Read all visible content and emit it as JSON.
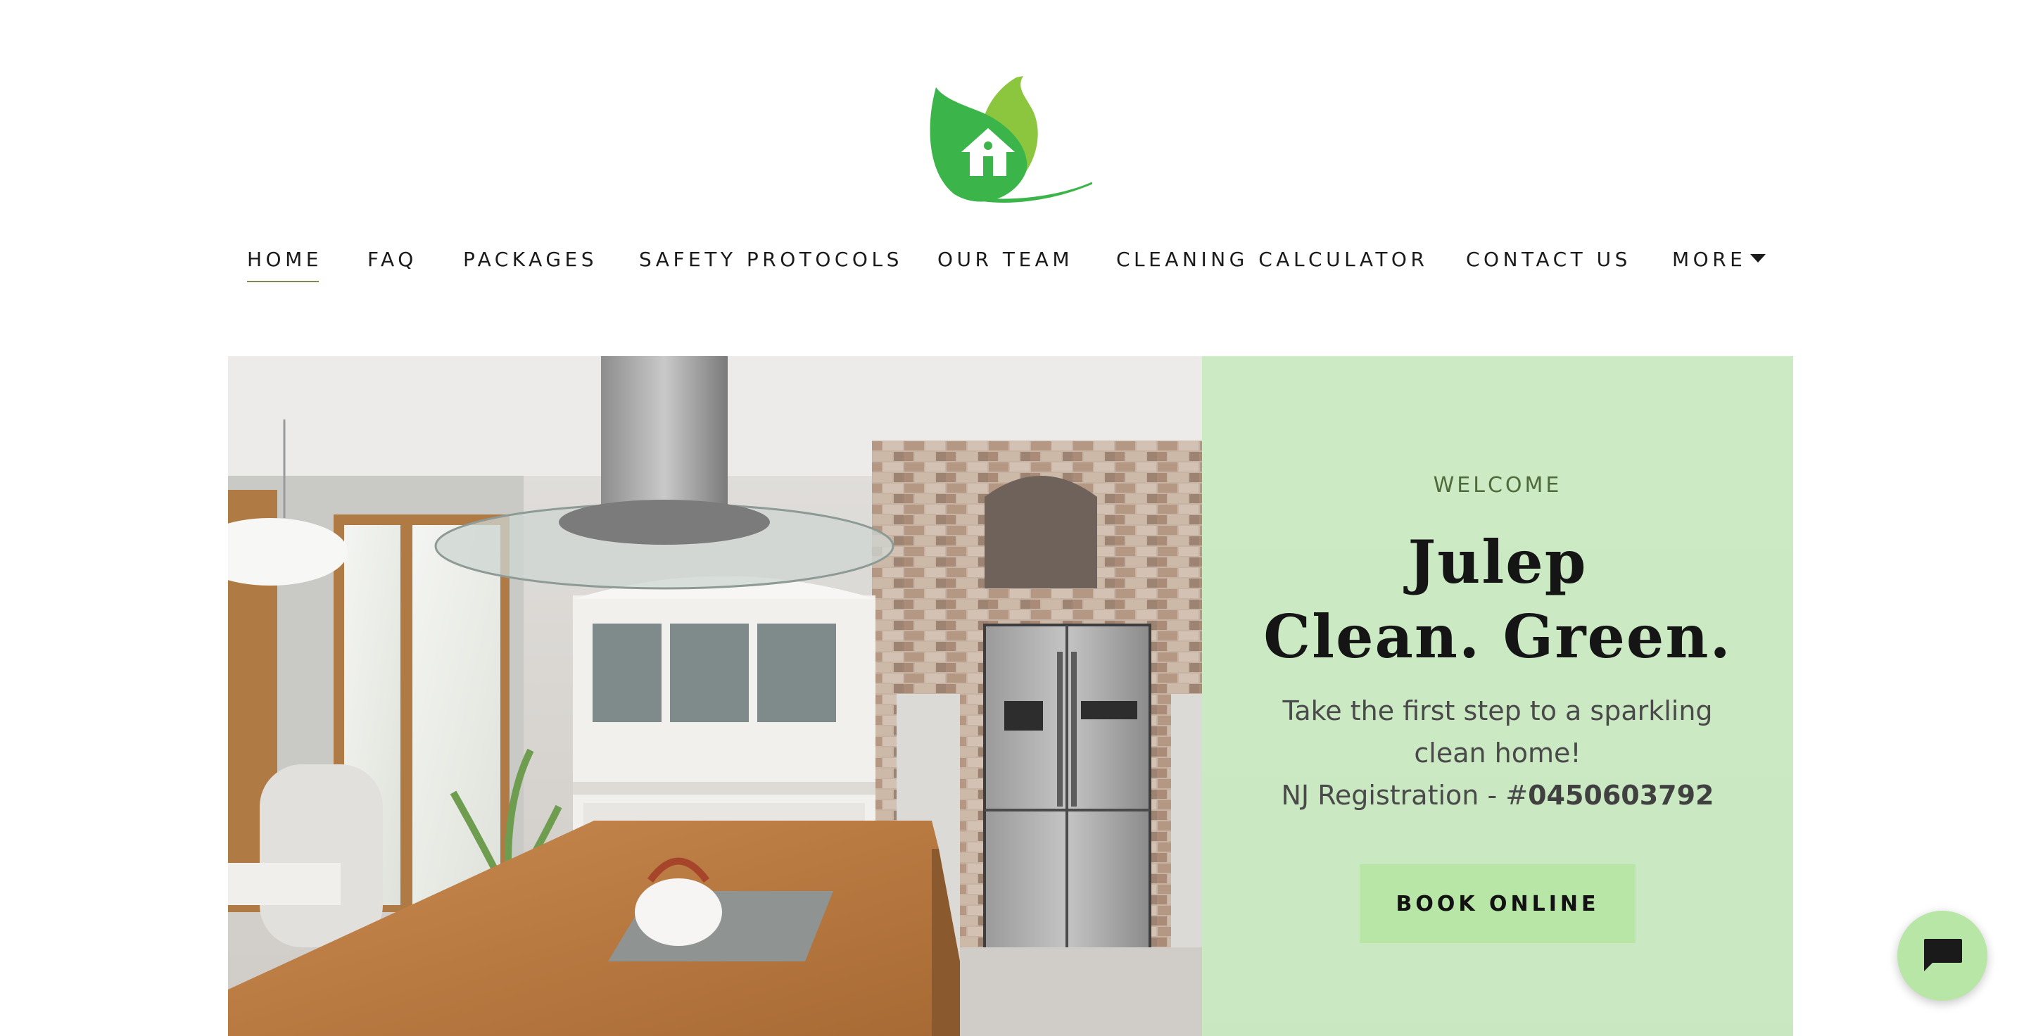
{
  "brand": {
    "logo_icon": "leaf-house-logo",
    "colors": {
      "leaf_dark": "#3bb54a",
      "leaf_light": "#8cc63f"
    }
  },
  "nav": {
    "items": [
      {
        "label": "HOME",
        "active": true
      },
      {
        "label": "FAQ"
      },
      {
        "label": "PACKAGES"
      },
      {
        "label": "SAFETY PROTOCOLS"
      },
      {
        "label": "OUR TEAM"
      },
      {
        "label": "CLEANING CALCULATOR"
      },
      {
        "label": "CONTACT US"
      },
      {
        "label": "MORE",
        "icon": "caret-down-icon"
      }
    ],
    "active_underline_color": "#7d8a52"
  },
  "hero": {
    "eyebrow": "WELCOME",
    "headline_line1": "Julep",
    "headline_line2": "Clean. Green.",
    "subtext_line1": "Take the first step to a sparkling clean home!",
    "registration_label": "NJ Registration - #",
    "registration_number": "0450603792",
    "cta_label": "BOOK ONLINE",
    "panel_color": "#c8ecc0",
    "cta_color": "#b8e6a6",
    "image_subject": "kitchen-interior-photo"
  },
  "chat": {
    "icon": "chat-bubble-icon",
    "color": "#b8e6a6"
  }
}
